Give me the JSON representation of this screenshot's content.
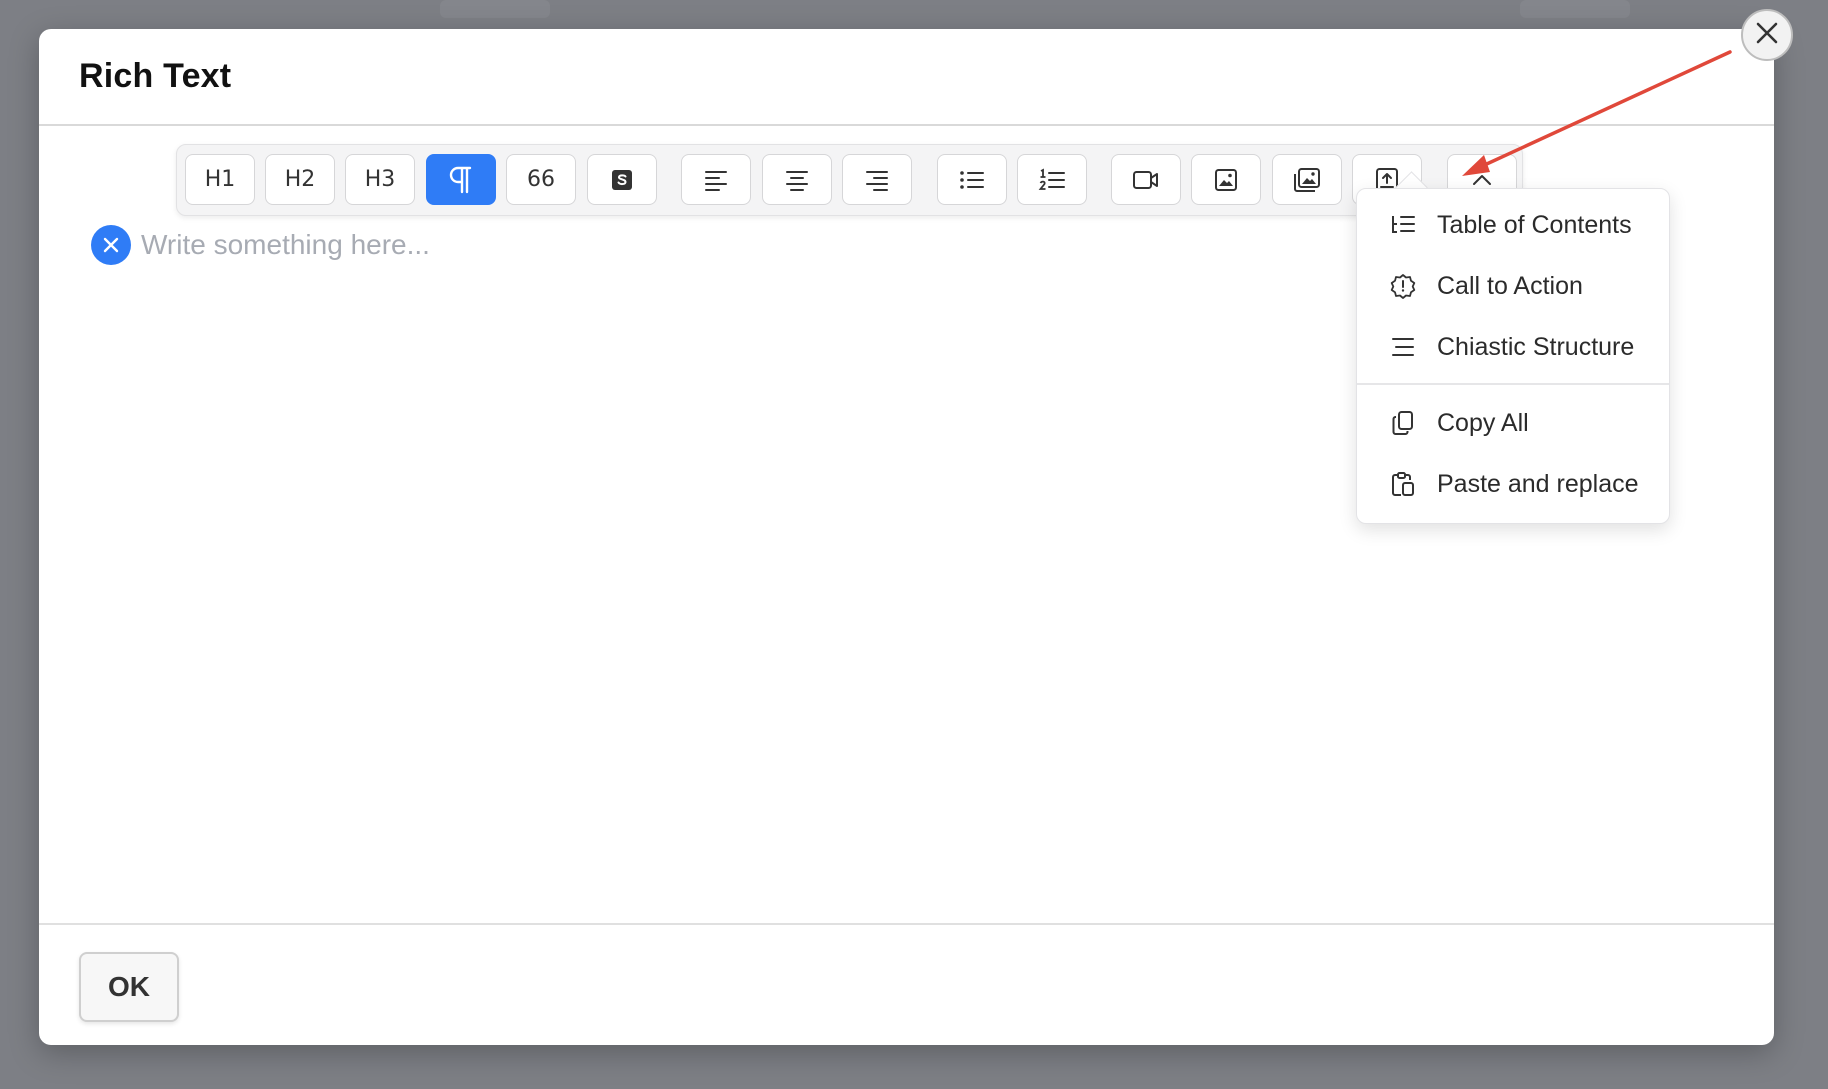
{
  "modal": {
    "title": "Rich Text",
    "placeholder": "Write something here...",
    "ok_label": "OK"
  },
  "toolbar": {
    "buttons": [
      {
        "name": "heading-1",
        "label": "H1"
      },
      {
        "name": "heading-2",
        "label": "H2"
      },
      {
        "name": "heading-3",
        "label": "H3"
      },
      {
        "name": "paragraph",
        "icon": "pilcrow-icon",
        "active": true
      },
      {
        "name": "quote",
        "label": "66"
      },
      {
        "name": "strikethrough",
        "icon": "s-square-icon"
      },
      {
        "name": "align-left",
        "icon": "align-left-icon"
      },
      {
        "name": "align-center",
        "icon": "align-center-icon"
      },
      {
        "name": "align-right",
        "icon": "align-right-icon"
      },
      {
        "name": "bullet-list",
        "icon": "bullet-list-icon"
      },
      {
        "name": "numbered-list",
        "icon": "numbered-list-icon"
      },
      {
        "name": "video",
        "icon": "video-icon"
      },
      {
        "name": "image",
        "icon": "image-icon"
      },
      {
        "name": "gallery",
        "icon": "gallery-icon"
      },
      {
        "name": "upload",
        "icon": "upload-icon"
      },
      {
        "name": "more",
        "icon": "chevron-up-icon"
      }
    ]
  },
  "dropdown": {
    "items": [
      {
        "label": "Table of Contents",
        "icon": "list-tree-icon"
      },
      {
        "label": "Call to Action",
        "icon": "alert-badge-icon"
      },
      {
        "label": "Chiastic Structure",
        "icon": "lines-icon"
      },
      {
        "label": "Copy All",
        "icon": "copy-icon"
      },
      {
        "label": "Paste and replace",
        "icon": "paste-icon"
      }
    ]
  },
  "colors": {
    "accent": "#2f7cf6",
    "annotation_arrow": "#e0483a",
    "overlay": "#7d7f85"
  }
}
